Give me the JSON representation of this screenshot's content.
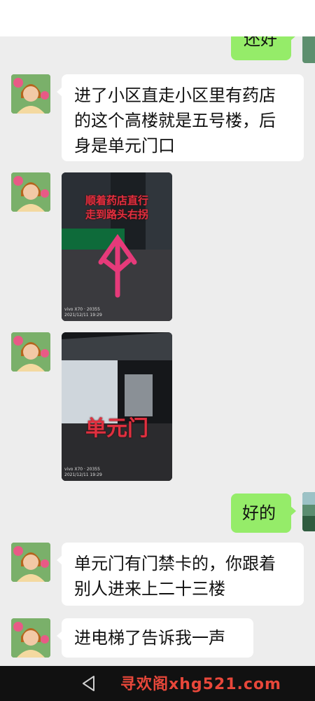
{
  "messages": {
    "partial_top": "还好",
    "m1": {
      "line1": "进了小区直走小区里有药店",
      "line2": "的这个高楼就是五号楼，后",
      "line3": "身是单元门口"
    },
    "photo1": {
      "caption_line1": "顺着药店直行",
      "caption_line2": "走到路头右拐",
      "meta_line1": "vivo X70 · 20355",
      "meta_line2": "2021/12/11 19:29"
    },
    "photo2": {
      "caption": "单元门",
      "meta_line1": "vivo X70 · 20355",
      "meta_line2": "2021/12/11 19:29"
    },
    "m2": "好的",
    "m3": {
      "line1": "单元门有门禁卡的，你跟着",
      "line2": "别人进来上二十三楼"
    },
    "m4": "进电梯了告诉我一声"
  },
  "navbar": {
    "watermark": "寻欢阁xhg521.com"
  },
  "colors": {
    "self_bubble": "#95ec69",
    "other_bubble": "#ffffff",
    "background": "#ededed"
  }
}
